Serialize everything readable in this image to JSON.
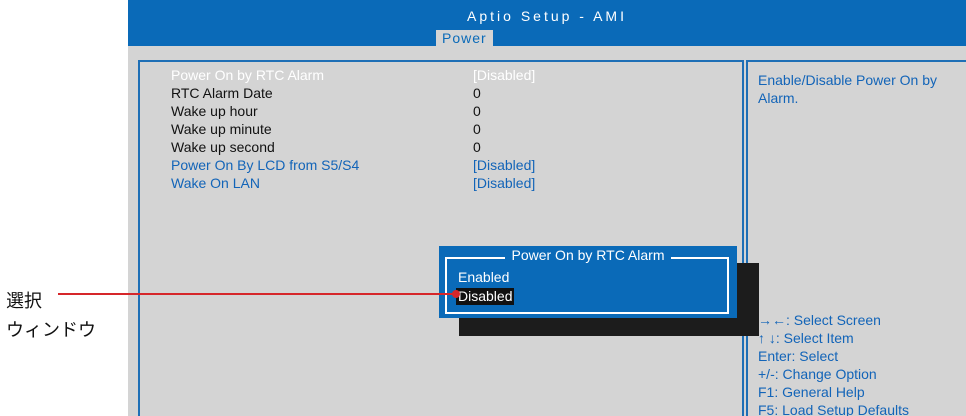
{
  "header": {
    "title": "Aptio Setup - AMI",
    "active_tab": "Power"
  },
  "colors": {
    "header_bg": "#0a6ab8",
    "panel_bg": "#d4d4d4",
    "highlight_text": "#ffffff",
    "option_link": "#1264b8",
    "callout_line": "#d6262a"
  },
  "options": [
    {
      "label": "Power On by RTC Alarm",
      "value": "[Disabled]"
    },
    {
      "label": "RTC Alarm Date",
      "value": "0"
    },
    {
      "label": "Wake up hour",
      "value": "0"
    },
    {
      "label": "Wake up minute",
      "value": "0"
    },
    {
      "label": "Wake up second",
      "value": "0"
    },
    {
      "label": "Power On By LCD from S5/S4",
      "value": "[Disabled]"
    },
    {
      "label": "Wake On LAN",
      "value": "[Disabled]"
    }
  ],
  "help": {
    "description": [
      "Enable/Disable Power On by",
      "Alarm."
    ],
    "keys": [
      "→←: Select Screen",
      "↑ ↓: Select Item",
      "Enter: Select",
      "+/-: Change Option",
      "F1: General Help",
      "F5: Load Setup Defaults"
    ]
  },
  "popup": {
    "title": "Power On by RTC Alarm",
    "items": [
      "Enabled",
      "Disabled"
    ],
    "selected": "Disabled"
  },
  "callout": {
    "line1": "選択",
    "line2": "ウィンドウ"
  }
}
